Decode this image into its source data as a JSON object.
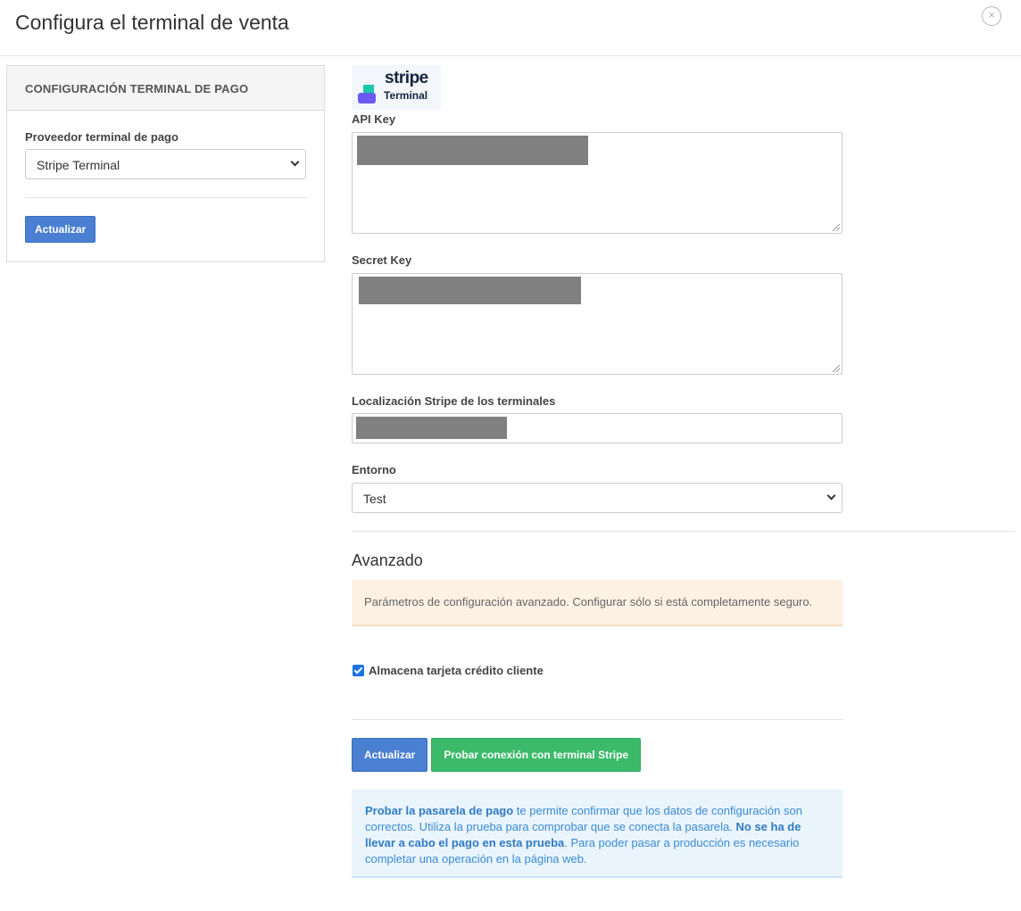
{
  "header": {
    "title": "Configura el terminal de venta",
    "close_icon": "close-icon",
    "close_glyph": "×"
  },
  "sidebar": {
    "heading": "CONFIGURACIÓN TERMINAL DE PAGO",
    "provider_label": "Proveedor terminal de pago",
    "provider_value": "Stripe Terminal",
    "update_label": "Actualizar"
  },
  "main": {
    "logo": {
      "brand": "stripe",
      "sub": "Terminal",
      "colors": {
        "top": "#1ac8a8",
        "bottom": "#6b5bf2"
      }
    },
    "api_key_label": "API Key",
    "secret_key_label": "Secret Key",
    "location_label": "Localización Stripe de los terminales",
    "environment_label": "Entorno",
    "environment_value": "Test",
    "advanced_title": "Avanzado",
    "advanced_warning": "Parámetros de configuración avanzado. Configurar sólo si está completamente seguro.",
    "store_card_label": "Almacena tarjeta crédito cliente",
    "store_card_checked": true,
    "update_label": "Actualizar",
    "test_label": "Probar conexión con terminal Stripe",
    "info": {
      "bold1": "Probar la pasarela de pago",
      "text1": " te permite confirmar que los datos de configuración son correctos. Utiliza la prueba para comprobar que se conecta la pasarela. ",
      "bold2": "No se ha de llevar a cabo el pago en esta prueba",
      "text2": ". Para poder pasar a producción es necesario completar una operación en la página web."
    }
  },
  "colors": {
    "primary_button": "#4a7fd1",
    "success_button": "#3cba6a",
    "warning_bg": "#fdf1e4",
    "info_bg": "#eaf4fd",
    "redaction": "#808080"
  }
}
